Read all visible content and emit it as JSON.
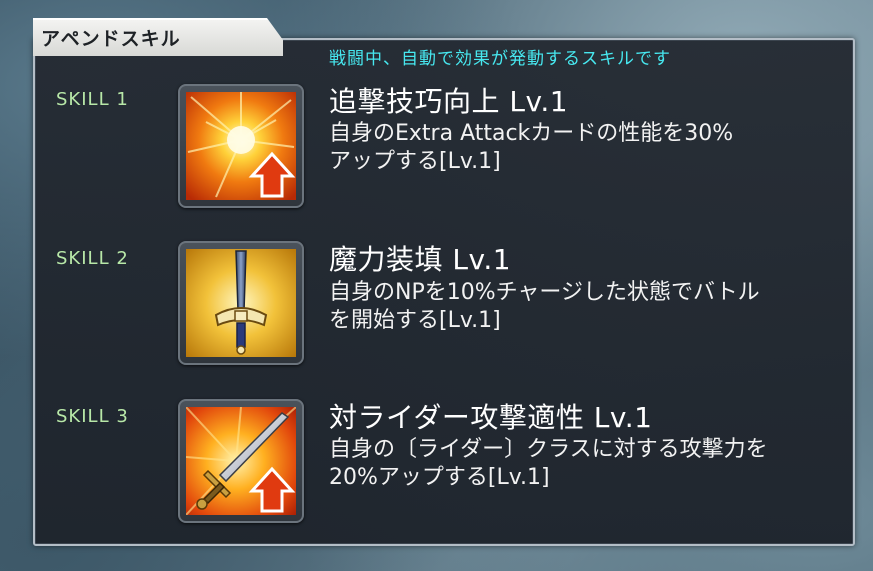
{
  "panel": {
    "title": "アペンドスキル",
    "subtitle": "戦闘中、自動で効果が発動するスキルです"
  },
  "skills": [
    {
      "label": "SKILL 1",
      "name": "追撃技巧向上 Lv.1",
      "desc_line1": "自身のExtra Attackカードの性能を30%",
      "desc_line2": "アップする[Lv.1]",
      "icon": "flame-burst-up-arrow-icon"
    },
    {
      "label": "SKILL 2",
      "name": "魔力装填 Lv.1",
      "desc_line1": "自身のNPを10%チャージした状態でバトル",
      "desc_line2": "を開始する[Lv.1]",
      "icon": "golden-sword-icon"
    },
    {
      "label": "SKILL 3",
      "name": "対ライダー攻撃適性 Lv.1",
      "desc_line1": "自身の〔ライダー〕クラスに対する攻撃力を",
      "desc_line2": "20%アップする[Lv.1]",
      "icon": "sword-up-arrow-icon"
    }
  ],
  "colors": {
    "subtitle": "#47e8f0",
    "skill_label": "#b8e8a8",
    "panel_bg": "#242a32",
    "arrow_red": "#e03a10"
  }
}
